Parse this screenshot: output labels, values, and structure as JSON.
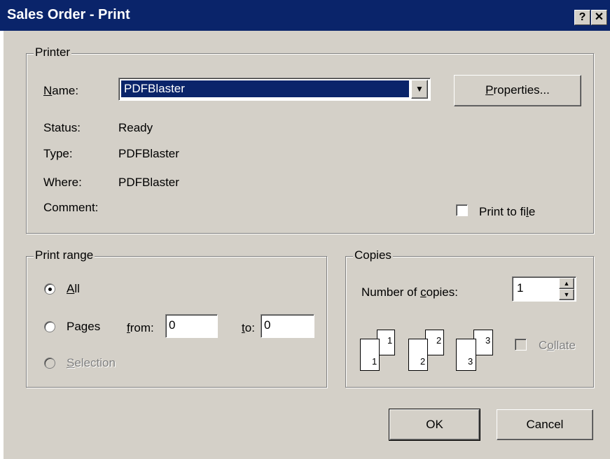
{
  "window": {
    "title": "Sales Order - Print",
    "help_button": "?",
    "close_button": "✕"
  },
  "printer": {
    "group_label": "Printer",
    "name_label": "Name:",
    "name_value": "PDFBlaster",
    "properties_button": "Properties...",
    "status_label": "Status:",
    "status_value": "Ready",
    "type_label": "Type:",
    "type_value": "PDFBlaster",
    "where_label": "Where:",
    "where_value": "PDFBlaster",
    "comment_label": "Comment:",
    "print_to_file_label": "Print to file"
  },
  "print_range": {
    "group_label": "Print range",
    "all_label": "All",
    "pages_label": "Pages",
    "from_label": "from:",
    "from_value": "0",
    "to_label": "to:",
    "to_value": "0",
    "selection_label": "Selection"
  },
  "copies": {
    "group_label": "Copies",
    "number_label": "Number of copies:",
    "number_value": "1",
    "collate_label": "Collate",
    "collate_pages": [
      "1",
      "1",
      "2",
      "2",
      "3",
      "3"
    ]
  },
  "buttons": {
    "ok": "OK",
    "cancel": "Cancel"
  }
}
